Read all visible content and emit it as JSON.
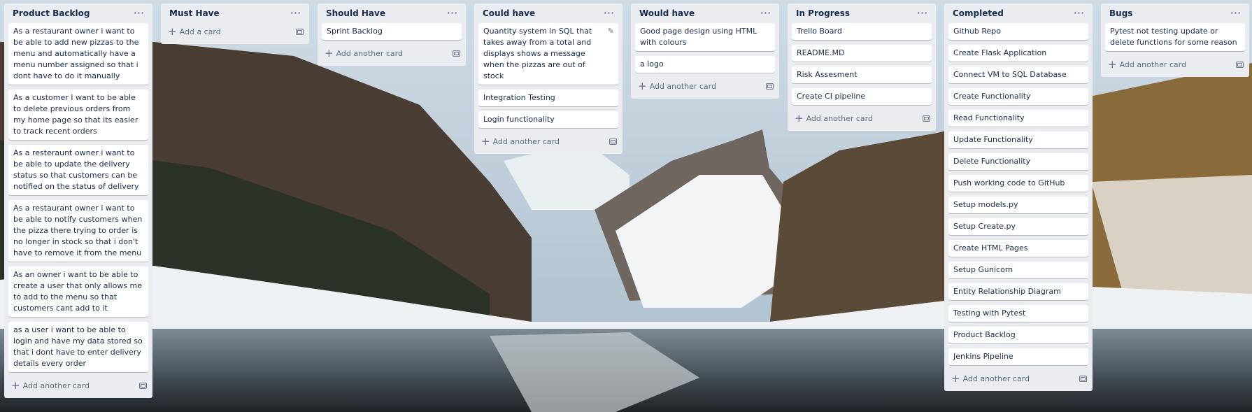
{
  "board": {
    "lists": [
      {
        "title": "Product Backlog",
        "cards": [
          "As a restaurant owner i want to be able to add new pizzas to the menu and automatically have a menu number assigned so that i dont have to do it manually",
          "As a customer I want to be able to delete previous orders from my home page so that its easier to track recent orders",
          "As a resteraunt owner i want to be able to update the delivery status so that customers can be notified on the status of delivery",
          "As a restaurant owner i want to be able to notify customers when the pizza there trying to order is no longer in stock so that i don't have to remove it from the menu",
          "As an owner i want to be able to create a user that only allows me to add to the menu so that customers cant add to it",
          "as a user i want to be able to login and have my data stored so that i dont have to enter delivery details every order"
        ],
        "add_label": "Add another card"
      },
      {
        "title": "Must Have",
        "cards": [],
        "add_label": "Add a card"
      },
      {
        "title": "Should Have",
        "cards": [
          "Sprint Backlog"
        ],
        "add_label": "Add another card"
      },
      {
        "title": "Could have",
        "cards": [
          "Quantity system in SQL that takes away from a total and displays shows a message when the pizzas are out of stock",
          "Integration Testing",
          "Login functionality"
        ],
        "add_label": "Add another card"
      },
      {
        "title": "Would have",
        "cards": [
          "Good page design using HTML with colours",
          "a logo"
        ],
        "add_label": "Add another card"
      },
      {
        "title": "In Progress",
        "cards": [
          "Trello Board",
          "README.MD",
          "Risk Assesment",
          "Create CI pipeline"
        ],
        "add_label": "Add another card"
      },
      {
        "title": "Completed",
        "cards": [
          "Github Repo",
          "Create Flask Application",
          "Connect VM to SQL Database",
          "Create Functionality",
          "Read Functionality",
          "Update Functionality",
          "Delete Functionality",
          "Push working code to GitHub",
          "Setup models.py",
          "Setup Create.py",
          "Create HTML Pages",
          "Setup Gunicorn",
          "Entity Relationship Diagram",
          "Testing with Pytest",
          "Product Backlog",
          "Jenkins Pipeline"
        ],
        "add_label": "Add another card"
      },
      {
        "title": "Bugs",
        "cards": [
          "Pytest not testing update or delete functions for some reason"
        ],
        "add_label": "Add another card"
      }
    ]
  },
  "icons": {
    "menu": "ellipsis-icon",
    "add": "plus-icon",
    "template": "card-template-icon",
    "edit": "pencil-icon"
  },
  "colors": {
    "list_bg": "#ebecf0",
    "card_bg": "#ffffff",
    "text": "#172b4d",
    "muted": "#5e6c84"
  }
}
